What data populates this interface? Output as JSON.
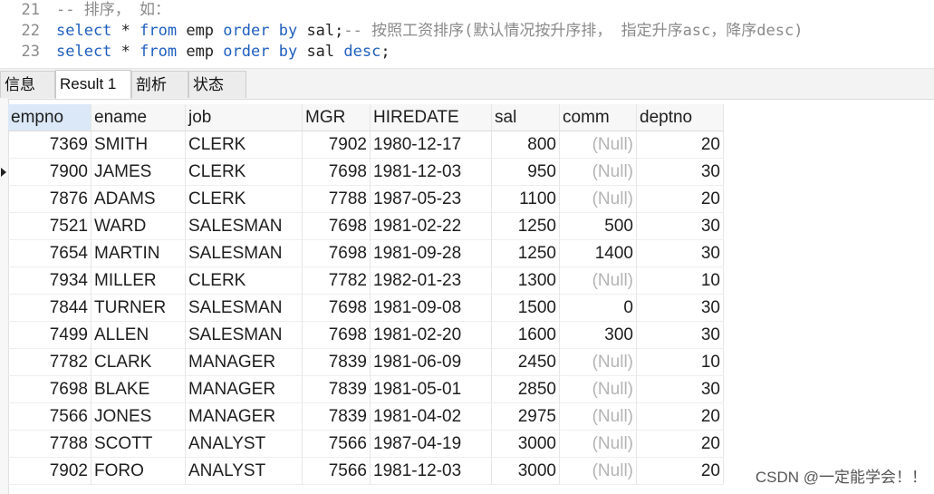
{
  "editor": {
    "lines": [
      {
        "no": "21",
        "parts": [
          {
            "t": "-- 排序， 如：",
            "c": "cm"
          }
        ]
      },
      {
        "no": "22",
        "parts": [
          {
            "t": "select",
            "c": "kw"
          },
          {
            "t": " * ",
            "c": ""
          },
          {
            "t": "from",
            "c": "kw"
          },
          {
            "t": " emp ",
            "c": ""
          },
          {
            "t": "order",
            "c": "kw"
          },
          {
            "t": " ",
            "c": ""
          },
          {
            "t": "by",
            "c": "kw"
          },
          {
            "t": " sal;",
            "c": ""
          },
          {
            "t": "-- 按照工资排序(默认情况按升序排， 指定升序asc，降序desc)",
            "c": "cm"
          }
        ]
      },
      {
        "no": "23",
        "parts": [
          {
            "t": "select",
            "c": "kw"
          },
          {
            "t": " * ",
            "c": ""
          },
          {
            "t": "from",
            "c": "kw"
          },
          {
            "t": " emp ",
            "c": ""
          },
          {
            "t": "order",
            "c": "kw"
          },
          {
            "t": " ",
            "c": ""
          },
          {
            "t": "by",
            "c": "kw"
          },
          {
            "t": " sal ",
            "c": ""
          },
          {
            "t": "desc",
            "c": "kw"
          },
          {
            "t": ";",
            "c": ""
          }
        ]
      }
    ]
  },
  "tabs": [
    "信息",
    "Result 1",
    "剖析",
    "状态"
  ],
  "active_tab": 1,
  "grid": {
    "columns": [
      "empno",
      "ename",
      "job",
      "MGR",
      "HIREDATE",
      "sal",
      "comm",
      "deptno"
    ],
    "selected_column": 0,
    "current_row": 1,
    "rows": [
      [
        "7369",
        "SMITH",
        "CLERK",
        "7902",
        "1980-12-17",
        "800",
        "(Null)",
        "20"
      ],
      [
        "7900",
        "JAMES",
        "CLERK",
        "7698",
        "1981-12-03",
        "950",
        "(Null)",
        "30"
      ],
      [
        "7876",
        "ADAMS",
        "CLERK",
        "7788",
        "1987-05-23",
        "1100",
        "(Null)",
        "20"
      ],
      [
        "7521",
        "WARD",
        "SALESMAN",
        "7698",
        "1981-02-22",
        "1250",
        "500",
        "30"
      ],
      [
        "7654",
        "MARTIN",
        "SALESMAN",
        "7698",
        "1981-09-28",
        "1250",
        "1400",
        "30"
      ],
      [
        "7934",
        "MILLER",
        "CLERK",
        "7782",
        "1982-01-23",
        "1300",
        "(Null)",
        "10"
      ],
      [
        "7844",
        "TURNER",
        "SALESMAN",
        "7698",
        "1981-09-08",
        "1500",
        "0",
        "30"
      ],
      [
        "7499",
        "ALLEN",
        "SALESMAN",
        "7698",
        "1981-02-20",
        "1600",
        "300",
        "30"
      ],
      [
        "7782",
        "CLARK",
        "MANAGER",
        "7839",
        "1981-06-09",
        "2450",
        "(Null)",
        "10"
      ],
      [
        "7698",
        "BLAKE",
        "MANAGER",
        "7839",
        "1981-05-01",
        "2850",
        "(Null)",
        "30"
      ],
      [
        "7566",
        "JONES",
        "MANAGER",
        "7839",
        "1981-04-02",
        "2975",
        "(Null)",
        "20"
      ],
      [
        "7788",
        "SCOTT",
        "ANALYST",
        "7566",
        "1987-04-19",
        "3000",
        "(Null)",
        "20"
      ],
      [
        "7902",
        "FORO",
        "ANALYST",
        "7566",
        "1981-12-03",
        "3000",
        "(Null)",
        "20"
      ]
    ]
  },
  "watermark": "CSDN @一定能学会！！",
  "colors": {
    "keyword": "#1f5fbf",
    "comment": "#8a8a8a",
    "null": "#b4b4b4",
    "selected_header": "#dbe8f7"
  }
}
